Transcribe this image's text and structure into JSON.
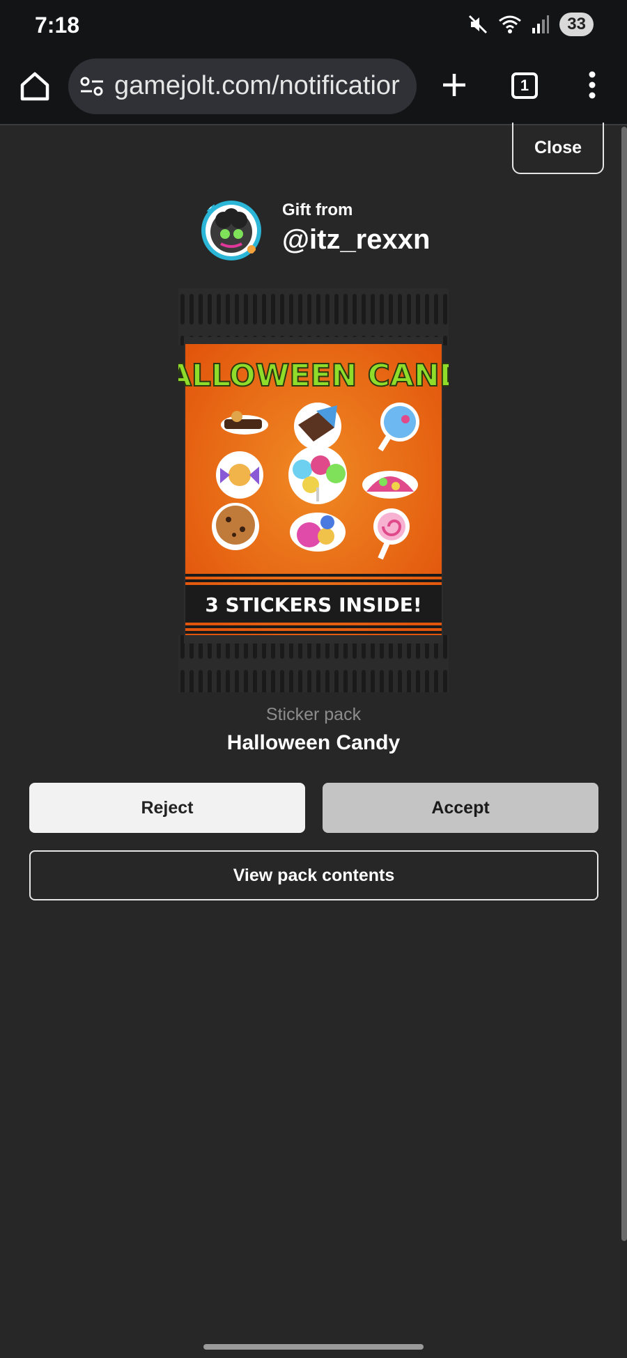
{
  "status_bar": {
    "time": "7:18",
    "battery": "33"
  },
  "browser": {
    "url": "gamejolt.com/notificatior",
    "tab_count": "1"
  },
  "modal": {
    "close_label": "Close",
    "gift_from_label": "Gift from",
    "username": "@itz_rexxn",
    "pack_art": {
      "headline": "HALLOWEEN CANDY",
      "banner": "3 STICKERS INSIDE!"
    },
    "item_kind": "Sticker pack",
    "item_name": "Halloween Candy",
    "reject_label": "Reject",
    "accept_label": "Accept",
    "view_contents_label": "View pack contents"
  },
  "colors": {
    "background": "#272727",
    "browser_chrome": "#131416",
    "pack_orange": "#ea6a12",
    "headline_green": "#8fdc2a"
  }
}
